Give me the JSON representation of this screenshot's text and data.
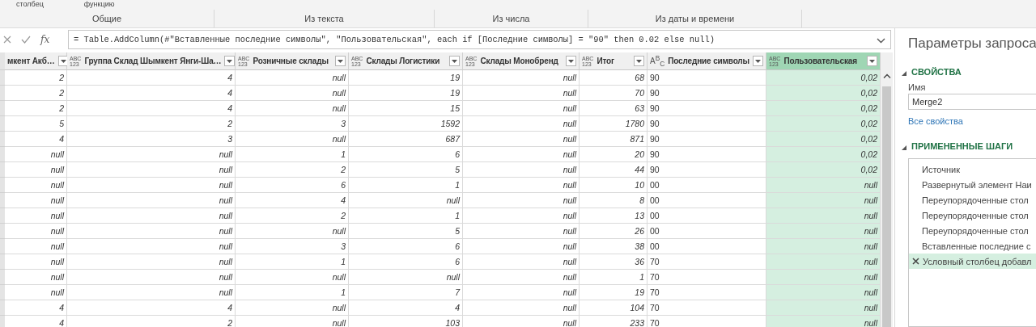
{
  "ribbon": {
    "commands": [
      "столбец",
      "функцию"
    ],
    "groups": [
      "Общие",
      "Из текста",
      "Из числа",
      "Из даты и времени"
    ]
  },
  "formula_bar": {
    "function_label": "fx",
    "formula": "= Table.AddColumn(#\"Вставленные последние символы\", \"Пользовательская\", each if [Последние символы] = \"90\" then 0.02 else null)"
  },
  "table": {
    "columns": [
      {
        "name": "мкент Акб…",
        "kind": "number",
        "selected": false
      },
      {
        "name": "Группа Склад Шымкент Янги-Ша…",
        "kind": "number",
        "selected": false,
        "type_label": {
          "kind": "stacked",
          "lines": [
            "ABC",
            "123"
          ]
        }
      },
      {
        "name": "Розничные склады",
        "kind": "number",
        "selected": false,
        "type_label": {
          "kind": "stacked",
          "lines": [
            "ABC",
            "123"
          ]
        }
      },
      {
        "name": "Склады Логистики",
        "kind": "number",
        "selected": false,
        "type_label": {
          "kind": "stacked",
          "lines": [
            "ABC",
            "123"
          ]
        }
      },
      {
        "name": "Склады Монобренд",
        "kind": "number",
        "selected": false,
        "type_label": {
          "kind": "stacked",
          "lines": [
            "ABC",
            "123"
          ]
        }
      },
      {
        "name": "Итог",
        "kind": "number",
        "selected": false,
        "type_label": {
          "kind": "stacked",
          "lines": [
            "ABC",
            "123"
          ]
        }
      },
      {
        "name": "Последние символы",
        "kind": "text",
        "selected": false,
        "type_label": {
          "kind": "script",
          "text": "A$^{B}$$_{C}$"
        }
      },
      {
        "name": "Пользовательская",
        "kind": "number",
        "selected": true,
        "type_label": {
          "kind": "stacked",
          "lines": [
            "ABC",
            "123"
          ]
        }
      }
    ],
    "rows": [
      [
        "2",
        "4",
        "null",
        "19",
        "null",
        "68",
        "90",
        "0,02"
      ],
      [
        "2",
        "4",
        "null",
        "19",
        "null",
        "70",
        "90",
        "0,02"
      ],
      [
        "2",
        "4",
        "null",
        "15",
        "null",
        "63",
        "90",
        "0,02"
      ],
      [
        "5",
        "2",
        "3",
        "1592",
        "null",
        "1780",
        "90",
        "0,02"
      ],
      [
        "4",
        "3",
        "null",
        "687",
        "null",
        "871",
        "90",
        "0,02"
      ],
      [
        "null",
        "null",
        "1",
        "6",
        "null",
        "20",
        "90",
        "0,02"
      ],
      [
        "null",
        "null",
        "2",
        "5",
        "null",
        "44",
        "90",
        "0,02"
      ],
      [
        "null",
        "null",
        "6",
        "1",
        "null",
        "10",
        "00",
        "null"
      ],
      [
        "null",
        "null",
        "4",
        "null",
        "null",
        "8",
        "00",
        "null"
      ],
      [
        "null",
        "null",
        "2",
        "1",
        "null",
        "13",
        "00",
        "null"
      ],
      [
        "null",
        "null",
        "null",
        "5",
        "null",
        "26",
        "00",
        "null"
      ],
      [
        "null",
        "null",
        "3",
        "6",
        "null",
        "38",
        "00",
        "null"
      ],
      [
        "null",
        "null",
        "1",
        "6",
        "null",
        "36",
        "70",
        "null"
      ],
      [
        "null",
        "null",
        "null",
        "null",
        "null",
        "1",
        "70",
        "null"
      ],
      [
        "null",
        "null",
        "1",
        "7",
        "null",
        "19",
        "70",
        "null"
      ],
      [
        "4",
        "4",
        "null",
        "4",
        "null",
        "104",
        "70",
        "null"
      ],
      [
        "4",
        "2",
        "null",
        "103",
        "null",
        "233",
        "70",
        "null"
      ]
    ]
  },
  "query_settings": {
    "title": "Параметры запроса",
    "properties": {
      "heading": "СВОЙСТВА",
      "expanded": true,
      "name_label": "Имя",
      "name_value": "Merge2",
      "link": "Все свойства"
    },
    "steps": {
      "heading": "ПРИМЕНЕННЫЕ ШАГИ",
      "expanded": true,
      "items": [
        {
          "label": "Источник",
          "selected": false
        },
        {
          "label": "Развернутый элемент Наи",
          "selected": false
        },
        {
          "label": "Переупорядоченные стол",
          "selected": false
        },
        {
          "label": "Переупорядоченные стол",
          "selected": false
        },
        {
          "label": "Переупорядоченные стол",
          "selected": false
        },
        {
          "label": "Вставленные последние с",
          "selected": false
        },
        {
          "label": "Условный столбец добавл",
          "selected": true
        }
      ]
    }
  }
}
